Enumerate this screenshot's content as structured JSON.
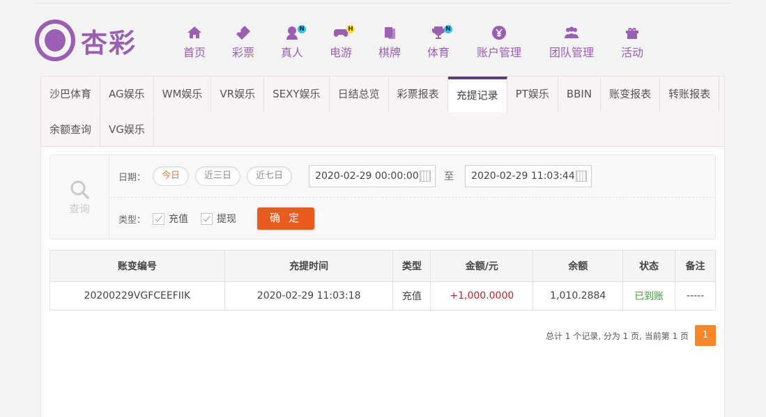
{
  "brand": {
    "name": "杏彩",
    "logo_icon": "flower-logo-icon",
    "accent": "#9a5fb1"
  },
  "nav": [
    {
      "label": "首页",
      "icon": "home-icon",
      "badge": ""
    },
    {
      "label": "彩票",
      "icon": "ticket-icon",
      "badge": ""
    },
    {
      "label": "真人",
      "icon": "dealer-icon",
      "badge": "N"
    },
    {
      "label": "电游",
      "icon": "gamepad-icon",
      "badge": "H"
    },
    {
      "label": "棋牌",
      "icon": "cards-icon",
      "badge": ""
    },
    {
      "label": "体育",
      "icon": "trophy-icon",
      "badge": "N"
    },
    {
      "label": "账户管理",
      "icon": "yen-coin-icon",
      "badge": ""
    },
    {
      "label": "团队管理",
      "icon": "team-icon",
      "badge": ""
    },
    {
      "label": "活动",
      "icon": "gift-icon",
      "badge": ""
    }
  ],
  "tabs": [
    "沙巴体育",
    "AG娱乐",
    "WM娱乐",
    "VR娱乐",
    "SEXY娱乐",
    "日结总览",
    "彩票报表",
    "充提记录",
    "PT娱乐",
    "BBIN",
    "账变报表",
    "转账报表",
    "余额查询",
    "VG娱乐"
  ],
  "active_tab": "充提记录",
  "query": {
    "side_label": "查询",
    "date_label": "日期：",
    "quick_ranges": [
      "今日",
      "近三日",
      "近七日"
    ],
    "active_range": "今日",
    "start": "2020-02-29 00:00:00",
    "to_label": "至",
    "end": "2020-02-29 11:03:44",
    "type_label": "类型：",
    "types": [
      "充值",
      "提现"
    ],
    "confirm_label": "确 定"
  },
  "table": {
    "headers": [
      "账变编号",
      "充提时间",
      "类型",
      "金额/元",
      "余额",
      "状态",
      "备注"
    ],
    "rows": [
      [
        "20200229VGFCEEFIIK",
        "2020-02-29 11:03:18",
        "充值",
        "+1,000.0000",
        "1,010.2884",
        "已到账",
        "-----"
      ]
    ]
  },
  "pager": {
    "summary": "总计 1 个记录, 分为 1 页, 当前第 1 页",
    "current": "1"
  },
  "colors": {
    "confirm": "#ea5b20",
    "amount": "#c8222b",
    "status_ok": "#37a832",
    "pager": "#f7862a"
  }
}
